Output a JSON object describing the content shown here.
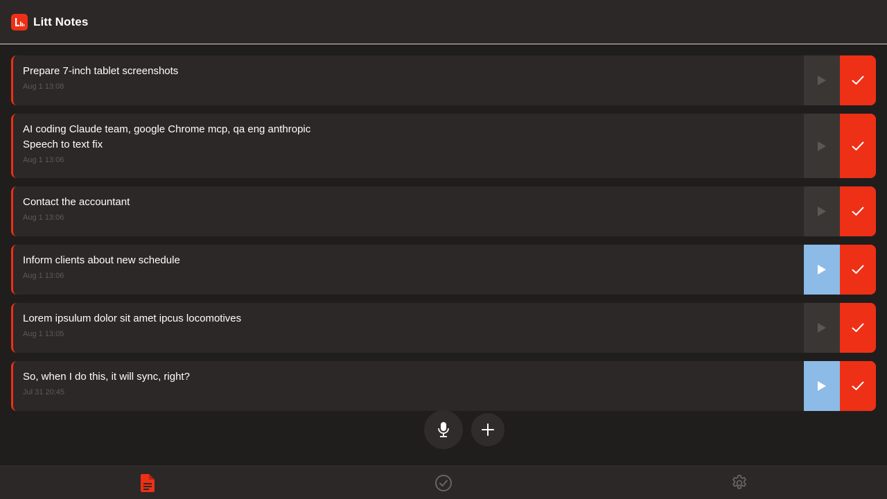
{
  "header": {
    "title": "Litt Notes",
    "logo_icon": "litt-logo-icon"
  },
  "notes": [
    {
      "text": "Prepare 7-inch tablet screenshots",
      "time": "Aug 1 13:08",
      "play_active": false
    },
    {
      "text": "AI coding Claude team, google Chrome mcp, qa eng anthropic\nSpeech to text fix",
      "time": "Aug 1 13:06",
      "play_active": false
    },
    {
      "text": "Contact the accountant",
      "time": "Aug 1 13:06",
      "play_active": false
    },
    {
      "text": "Inform clients about new schedule",
      "time": "Aug 1 13:06",
      "play_active": true
    },
    {
      "text": "Lorem ipsulum dolor sit amet ipcus locomotives",
      "time": "Aug 1 13:05",
      "play_active": false
    },
    {
      "text": "So, when I do this, it will sync, right?",
      "time": "Jul 31 20:45",
      "play_active": true
    }
  ],
  "actions": {
    "record_icon": "microphone-icon",
    "add_icon": "plus-icon"
  },
  "bottom_nav": [
    {
      "name": "notes",
      "icon": "document-icon",
      "active": true
    },
    {
      "name": "completed",
      "icon": "check-circle-icon",
      "active": false
    },
    {
      "name": "settings",
      "icon": "gear-icon",
      "active": false
    }
  ],
  "colors": {
    "accent": "#ee3016",
    "play_active": "#8cbbe8",
    "background": "#201e1d",
    "card": "#2b2827"
  }
}
